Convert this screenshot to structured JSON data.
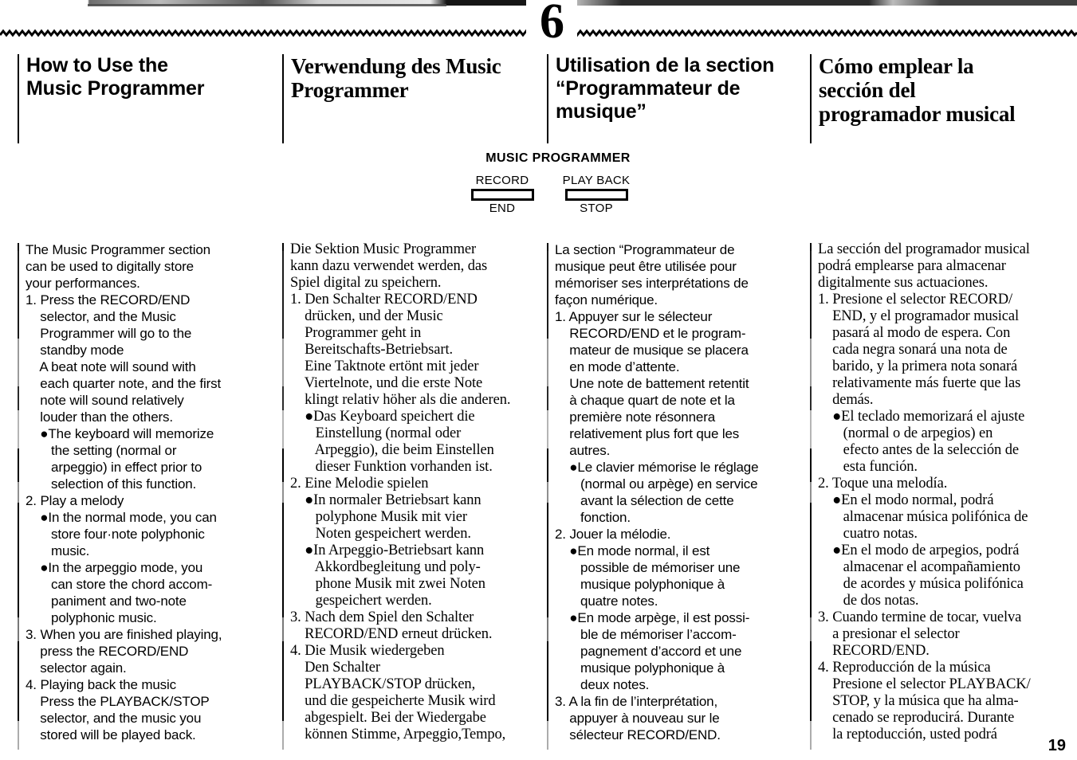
{
  "page": {
    "chapter_number": "6",
    "page_number": "19"
  },
  "headings": {
    "english": "How to Use the\nMusic Programmer",
    "german": "Verwendung des Music\nProgrammer",
    "french": "Utilisation de la section\n“Programmateur de\nmusique”",
    "spanish": "Cómo emplear la\nsección del\nprogramador musical"
  },
  "panel": {
    "caption": "MUSIC PROGRAMMER",
    "switches": [
      {
        "top_label": "RECORD",
        "bottom_label": "END"
      },
      {
        "top_label": "PLAY BACK",
        "bottom_label": "STOP"
      }
    ]
  },
  "body": {
    "english": "The Music Programmer section\ncan be used to digitally store\nyour performances.\n1. Press the RECORD/END\n    selector, and the Music\n    Programmer will go to the\n    standby mode\n    A beat note will sound with\n    each quarter note, and the first\n    note will sound relatively\n    louder than the others.\n    ●The keyboard will memorize\n       the setting (normal or\n       arpeggio) in effect prior to\n       selection of this function.\n2. Play a melody\n    ●In the normal mode, you can\n       store four·note polyphonic\n       music.\n    ●In the arpeggio mode, you\n       can store the chord accom-\n       paniment and two-note\n       polyphonic music.\n3. When you are finished playing,\n    press the RECORD/END\n    selector again.\n4. Playing back the music\n    Press the PLAYBACK/STOP\n    selector, and the music you\n    stored will be played back.",
    "german": "Die Sektion Music Programmer\nkann dazu verwendet werden, das\nSpiel digital zu speichern.\n1. Den Schalter RECORD/END\n    drücken, und der Music\n    Programmer geht in\n    Bereitschafts-Betriebsart.\n    Eine Taktnote ertönt mit jeder\n    Viertelnote, und die erste Note\n    klingt relativ höher als die anderen.\n    ●Das Keyboard speichert die\n       Einstellung (normal oder\n       Arpeggio), die beim Einstellen\n       dieser Funktion vorhanden ist.\n2. Eine Melodie spielen\n    ●In normaler Betriebsart kann\n       polyphone Musik mit vier\n       Noten gespeichert werden.\n    ●In Arpeggio-Betriebsart kann\n       Akkordbegleitung und poly-\n       phone Musik mit zwei Noten\n       gespeichert werden.\n3. Nach dem Spiel den Schalter\n    RECORD/END erneut drücken.\n4. Die Musik wiedergeben\n    Den Schalter\n    PLAYBACK/STOP drücken,\n    und die gespeicherte Musik wird\n    abgespielt. Bei der Wiedergabe\n    können Stimme, Arpeggio,Tempo,",
    "french": "La section “Programmateur de\nmusique peut être utilisée pour\nmémoriser ses interprétations de\nfaçon numérique.\n1. Appuyer sur le sélecteur\n    RECORD/END et le program-\n    mateur de musique se placera\n    en mode d’attente.\n    Une note de battement retentit\n    à chaque quart de note et la\n    première note résonnera\n    relativement plus fort que les\n    autres.\n    ●Le clavier mémorise le réglage\n       (normal ou arpège) en service\n       avant la sélection de cette\n       fonction.\n2. Jouer la mélodie.\n    ●En mode normal, il est\n       possible de mémoriser une\n       musique polyphonique à\n       quatre notes.\n    ●En mode arpège, il est possi-\n       ble de mémoriser l’accom-\n       pagnement d’accord et une\n       musique polyphonique à\n       deux notes.\n3. A la fin de l’interprétation,\n    appuyer à nouveau sur le\n    sélecteur RECORD/END.",
    "spanish": "La sección del programador musical\npodrá emplearse para almacenar\ndigitalmente sus actuaciones.\n1. Presione el selector RECORD/\n    END, y el programador musical\n    pasará al modo de espera. Con\n    cada negra sonará una nota de\n    barido, y la primera nota sonará\n    relativamente más fuerte que las\n    demás.\n    ●El teclado memorizará el ajuste\n       (normal o de arpegios) en\n       efecto antes de la selección de\n       esta función.\n2. Toque una melodía.\n    ●En el modo normal, podrá\n       almacenar música polifónica de\n       cuatro notas.\n    ●En el modo de arpegios, podrá\n       almacenar el acompañamiento\n       de acordes y música polifónica\n       de dos notas.\n3. Cuando termine de tocar, vuelva\n    a presionar el selector\n    RECORD/END.\n4. Reproducción de la música\n    Presione el selector PLAYBACK/\n    STOP, y la música que ha alma-\n    cenado se reproducirá. Durante\n    la reptoducción, usted podrá"
  }
}
